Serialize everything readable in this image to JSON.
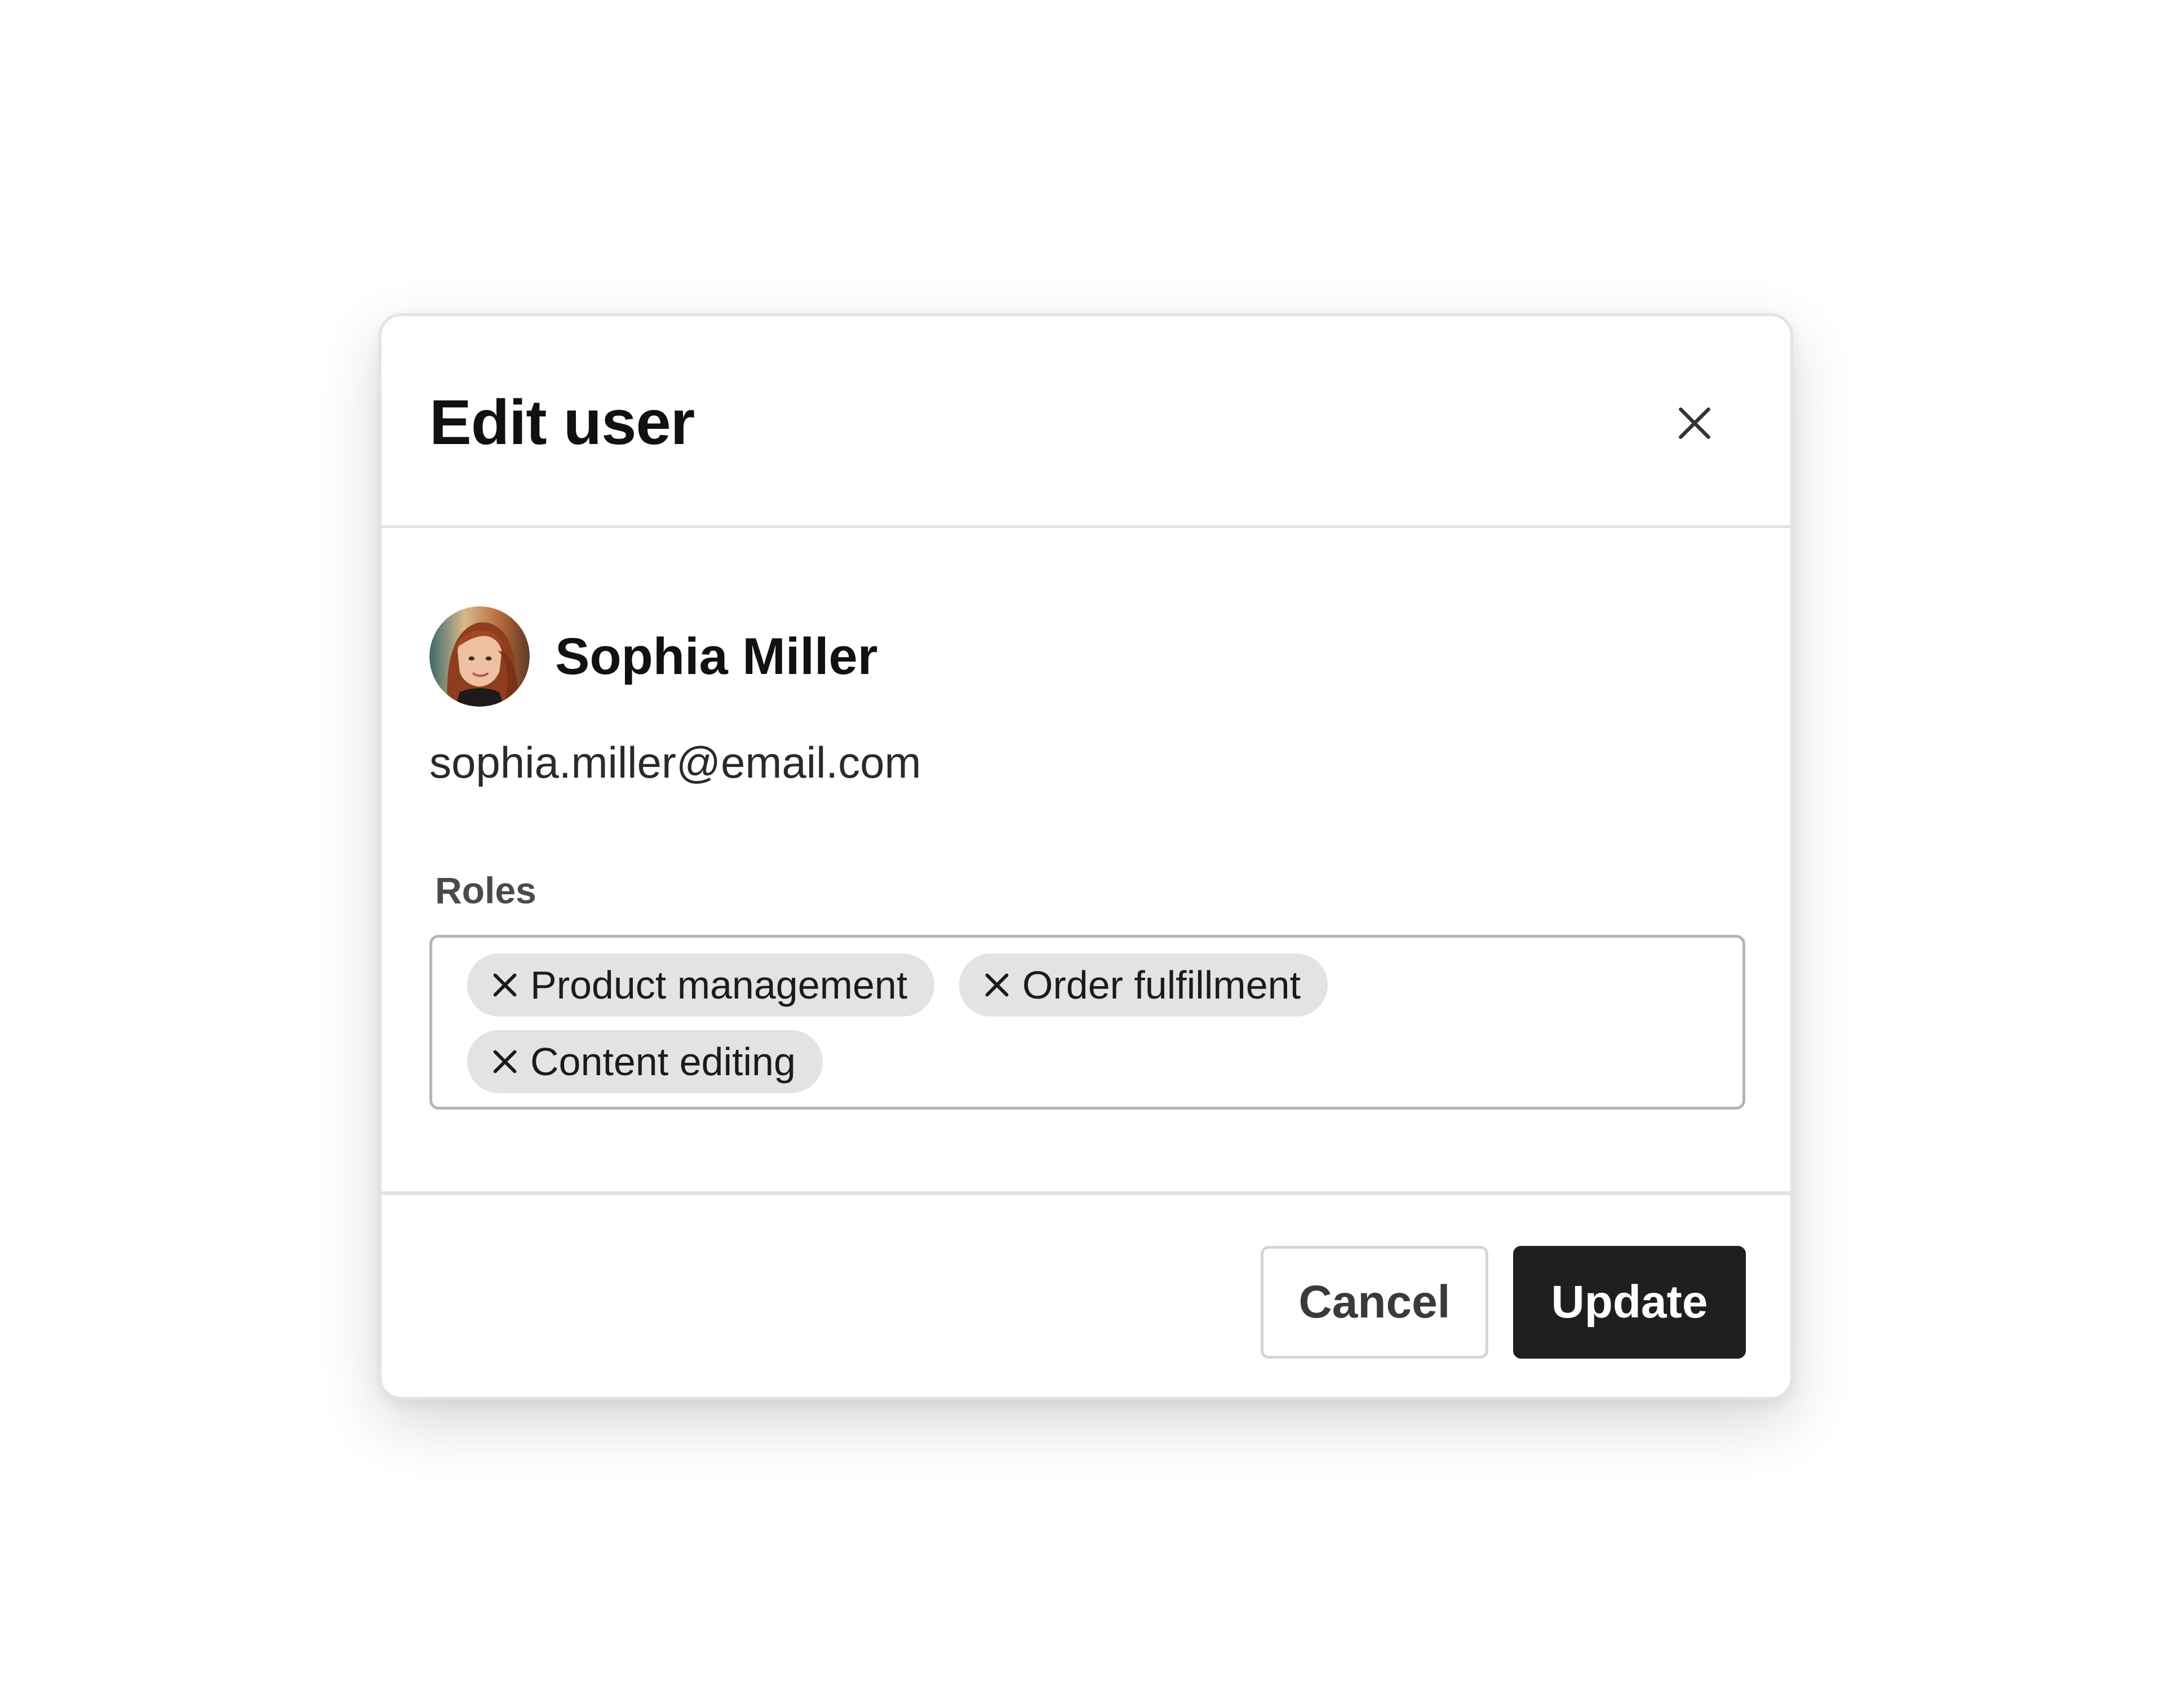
{
  "modal": {
    "title": "Edit user",
    "close_icon": "close-icon"
  },
  "user": {
    "name": "Sophia Miller",
    "email": "sophia.miller@email.com",
    "avatar_icon": "user-avatar-photo"
  },
  "roles": {
    "label": "Roles",
    "selected": [
      {
        "label": "Product management",
        "remove_icon": "close-icon"
      },
      {
        "label": "Order fulfillment",
        "remove_icon": "close-icon"
      },
      {
        "label": "Content editing",
        "remove_icon": "close-icon"
      }
    ]
  },
  "footer": {
    "cancel_label": "Cancel",
    "update_label": "Update"
  },
  "colors": {
    "primary_button": "#1f1f1f",
    "chip_background": "#e3e3e3",
    "border": "#e3e3e3",
    "input_border": "#b5b5b5"
  }
}
